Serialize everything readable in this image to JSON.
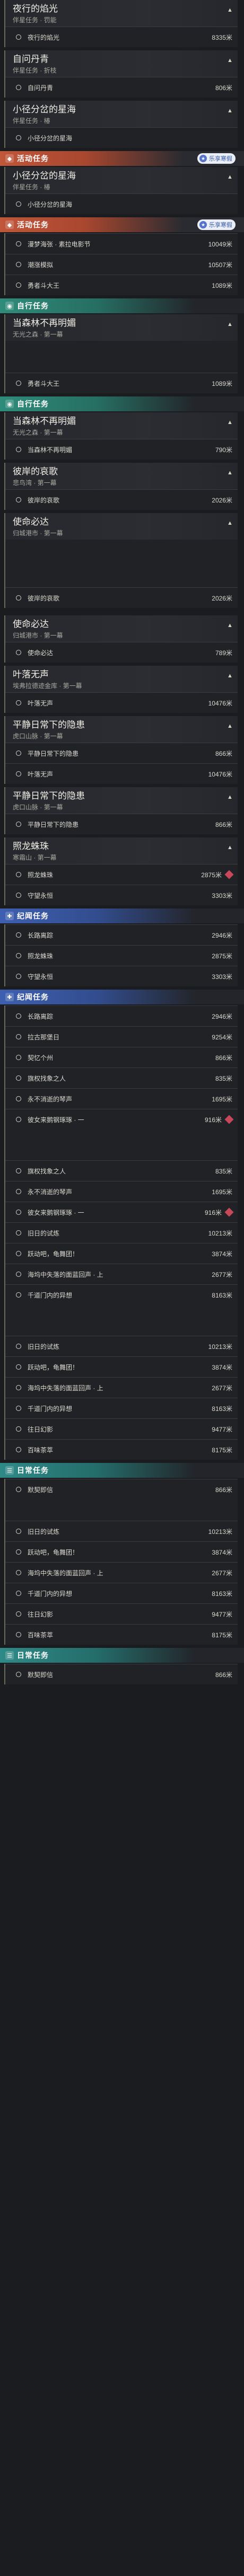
{
  "markers": {
    "alert_color": "#c8475a"
  },
  "sections": {
    "activity": "活动任务",
    "roaming": "自行任务",
    "discipline": "纪闻任务",
    "daily": "日常任务"
  },
  "badge": {
    "label": "乐享寒假",
    "icon": "star-icon"
  },
  "cards": [
    {
      "title": "夜行的焰光",
      "sub": "伴星任务 · 罚能",
      "chev": "▲",
      "objs": [
        {
          "t": "夜行的焰光",
          "d": "8335米"
        }
      ]
    },
    {
      "title": "自问丹青",
      "sub": "伴星任务 · 折枝",
      "chev": "▲",
      "objs": [
        {
          "t": "自问丹青",
          "d": "806米"
        }
      ]
    },
    {
      "title": "小径分岔的星海",
      "sub": "伴星任务 · 椿",
      "chev": "▲",
      "objs": [
        {
          "t": "小径分岔的星海",
          "d": ""
        }
      ]
    },
    {
      "title": "小径分岔的星海",
      "sub": "伴星任务 · 椿",
      "chev": "▲",
      "objs": [
        {
          "t": "小径分岔的星海",
          "d": ""
        }
      ]
    },
    {
      "title": "",
      "sub": "",
      "chev": "",
      "objs": [
        {
          "t": "漫梦海张 · 素拉电影节",
          "d": "10049米"
        },
        {
          "t": "潮涨模拟",
          "d": "10507米"
        },
        {
          "t": "勇者斗大王",
          "d": "1089米"
        }
      ]
    },
    {
      "title": "当森林不再明媚",
      "sub": "无光之森 · 第一幕",
      "chev": "▲",
      "objs": []
    },
    {
      "title": "",
      "sub": "",
      "chev": "",
      "objs": [
        {
          "t": "勇者斗大王",
          "d": "1089米"
        }
      ]
    },
    {
      "title": "当森林不再明媚",
      "sub": "无光之森 · 第一幕",
      "chev": "▲",
      "objs": [
        {
          "t": "当森林不再明媚",
          "d": "790米"
        }
      ]
    },
    {
      "title": "彼岸的哀歌",
      "sub": "悲鸟湾 · 第一幕",
      "chev": "▲",
      "objs": [
        {
          "t": "彼岸的哀歌",
          "d": "2026米"
        }
      ]
    },
    {
      "title": "使命必达",
      "sub": "归城港市 · 第一幕",
      "chev": "▲",
      "objs": [
        {
          "t": "",
          "d": ""
        },
        {
          "t": "彼岸的哀歌",
          "d": "2026米"
        }
      ]
    },
    {
      "title": "使命必达",
      "sub": "归城港市 · 第一幕",
      "chev": "▲",
      "objs": [
        {
          "t": "使命必达",
          "d": "789米"
        }
      ]
    },
    {
      "title": "叶落无声",
      "sub": "埃弗拉德迹金库 · 第一幕",
      "chev": "▲",
      "objs": [
        {
          "t": "叶落无声",
          "d": "10476米"
        }
      ]
    },
    {
      "title": "平静日常下的隐患",
      "sub": "虎口山脉 · 第一幕",
      "chev": "▲",
      "objs": [
        {
          "t": "平静日常下的隐患",
          "d": "866米"
        },
        {
          "t": "叶落无声",
          "d": "10476米"
        }
      ]
    },
    {
      "title": "平静日常下的隐患",
      "sub": "虎口山脉 · 第一幕",
      "chev": "▲",
      "objs": [
        {
          "t": "平静日常下的隐患",
          "d": "866米"
        }
      ]
    },
    {
      "title": "照龙蛛珠",
      "sub": "寒霜山 · 第一幕",
      "chev": "▲",
      "objs": [
        {
          "t": "照龙蛛珠",
          "d": "2875米"
        },
        {
          "t": "守望永恒",
          "d": "3303米"
        }
      ]
    },
    {
      "title": "",
      "sub": "",
      "chev": "",
      "objs": [
        {
          "t": "长路离踪",
          "d": "2946米"
        },
        {
          "t": "照龙蛛珠",
          "d": "2875米"
        },
        {
          "t": "守望永恒",
          "d": "3303米"
        }
      ]
    },
    {
      "title": "",
      "sub": "",
      "chev": "",
      "objs": [
        {
          "t": "长路离踪",
          "d": "2946米"
        },
        {
          "t": "拉古那堡日",
          "d": "9254米"
        },
        {
          "t": "契忆个州",
          "d": "866米"
        },
        {
          "t": "旗权找象之人",
          "d": "835米"
        },
        {
          "t": "永不消逝的琴声",
          "d": "1695米"
        },
        {
          "t": "彼女来鹅钢琢琢 · 一",
          "d": "916米"
        },
        {
          "t": "",
          "d": ""
        },
        {
          "t": "旗权找象之人",
          "d": "835米"
        },
        {
          "t": "永不消逝的琴声",
          "d": "1695米"
        },
        {
          "t": "彼女来鹅钢琢琢 · 一",
          "d": "916米"
        },
        {
          "t": "旧日的试炼",
          "d": "10213米"
        },
        {
          "t": "跃动吧，龟舞团！",
          "d": "3874米"
        },
        {
          "t": "海坞中失落的面蓝回声 · 上",
          "d": "2677米"
        },
        {
          "t": "千道门内的异想",
          "d": "8163米"
        },
        {
          "t": "",
          "d": ""
        },
        {
          "t": "旧日的试炼",
          "d": "10213米"
        },
        {
          "t": "跃动吧，龟舞团！",
          "d": "3874米"
        },
        {
          "t": "海坞中失落的面蓝回声 · 上",
          "d": "2677米"
        },
        {
          "t": "千道门内的异想",
          "d": "8163米"
        },
        {
          "t": "往日幻影",
          "d": "9477米"
        },
        {
          "t": "百味茶萃",
          "d": "8175米"
        }
      ]
    },
    {
      "title": "",
      "sub": "",
      "chev": "",
      "objs": [
        {
          "t": "默契即信",
          "d": "866米"
        },
        {
          "t": "旧日的试炼",
          "d": "10213米"
        },
        {
          "t": "跃动吧，龟舞团！",
          "d": "3874米"
        },
        {
          "t": "海坞中失落的面蓝回声 · 上",
          "d": "2677米"
        },
        {
          "t": "千道门内的异想",
          "d": "8163米"
        },
        {
          "t": "往日幻影",
          "d": "9477米"
        },
        {
          "t": "百味茶萃",
          "d": "8175米"
        }
      ]
    },
    {
      "title": "",
      "sub": "",
      "chev": "",
      "objs": [
        {
          "t": "默契即信",
          "d": "866米"
        }
      ]
    }
  ]
}
